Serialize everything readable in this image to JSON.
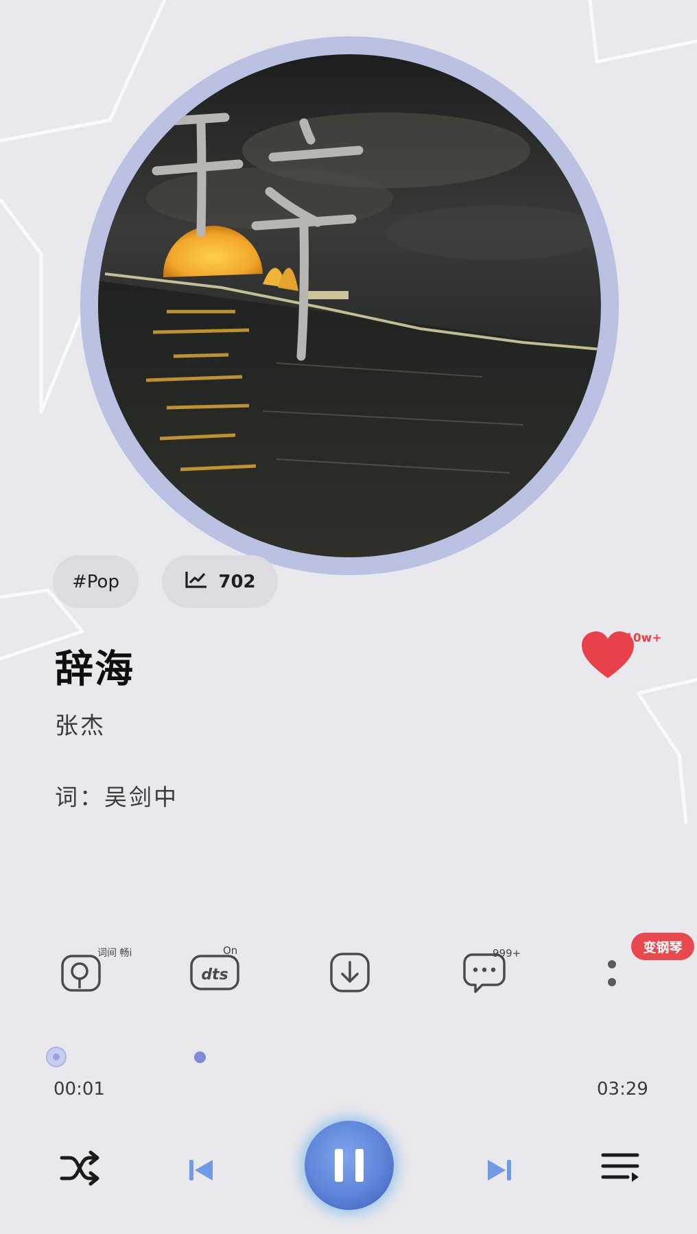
{
  "album": {
    "art_text": "辞"
  },
  "tags": {
    "genre": "#Pop",
    "plays": "702"
  },
  "song": {
    "title": "辞海",
    "artist": "张杰",
    "lyricist": "词：吴剑中"
  },
  "like": {
    "count": "10w+",
    "color": "#e8414c"
  },
  "actions": {
    "lyrics_tag": "词间 畅i",
    "dts_tag": "On",
    "comments_count": "999+",
    "piano_badge": "变钢琴"
  },
  "progress": {
    "current": "00:01",
    "duration": "03:29",
    "fraction": 0.005
  },
  "controls": {
    "state": "playing",
    "accent": "#5d84d8"
  },
  "icons": [
    "trend-icon",
    "heart-icon",
    "lyrics-icon",
    "dts-icon",
    "download-icon",
    "comment-icon",
    "more-icon",
    "shuffle-icon",
    "prev-icon",
    "pause-icon",
    "next-icon",
    "playlist-icon"
  ]
}
